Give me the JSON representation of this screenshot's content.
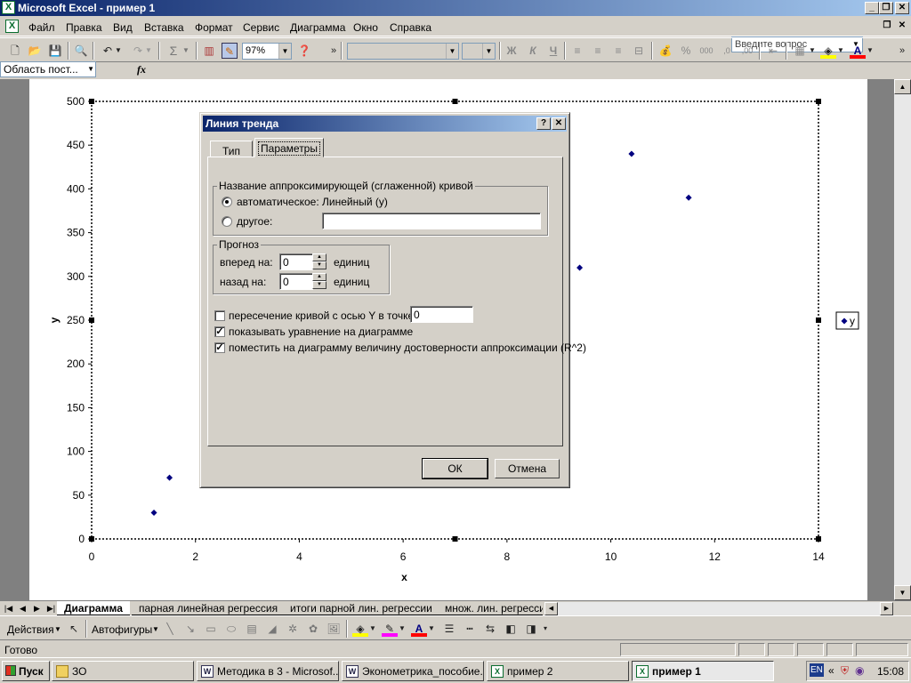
{
  "window": {
    "title": "Microsoft Excel - пример 1"
  },
  "menu": [
    "Файл",
    "Правка",
    "Вид",
    "Вставка",
    "Формат",
    "Сервис",
    "Диаграмма",
    "Окно",
    "Справка"
  ],
  "ask_placeholder": "Введите вопрос",
  "toolbar": {
    "zoom": "97%",
    "bold_icon": "Ж",
    "italic_icon": "К",
    "underline_icon": "Ч"
  },
  "formula_bar": {
    "name_box": "Область пост...",
    "fx": "fx"
  },
  "chart_data": {
    "type": "scatter",
    "x": [
      1.2,
      1.5,
      9.4,
      10.4,
      11.5
    ],
    "y": [
      30,
      70,
      310,
      440,
      390
    ],
    "xlabel": "x",
    "ylabel": "y",
    "xlim": [
      0,
      14
    ],
    "ylim": [
      0,
      500
    ],
    "xticks": [
      "0",
      "2",
      "4",
      "6",
      "8",
      "10",
      "12",
      "14"
    ],
    "yticks": [
      "0",
      "50",
      "100",
      "150",
      "200",
      "250",
      "300",
      "350",
      "400",
      "450",
      "500"
    ],
    "legend": {
      "entries": [
        "y"
      ],
      "placement": "right"
    },
    "grid": false,
    "marker_color": "#000080"
  },
  "dialog": {
    "title": "Линия тренда",
    "tabs": [
      "Тип",
      "Параметры"
    ],
    "name_group": "Название аппроксимирующей (сглаженной) кривой",
    "auto_label": "автоматическое:",
    "auto_value": "Линейный (y)",
    "other_label": "другое:",
    "forecast_group": "Прогноз",
    "forward_label": "вперед на:",
    "forward_value": "0",
    "back_label": "назад на:",
    "back_value": "0",
    "units": "единиц",
    "intercept_label": "пересечение кривой с осью Y в точке:",
    "intercept_value": "0",
    "show_equation": "показывать уравнение на диаграмме",
    "show_r2": "поместить на диаграмму величину достоверности аппроксимации (R^2)",
    "ok": "ОК",
    "cancel": "Отмена"
  },
  "sheet_tabs": [
    "Диаграмма",
    "парная линейная регрессия",
    "итоги парной лин. регрессии",
    "множ. лин. регресси"
  ],
  "drawing": {
    "actions": "Действия",
    "autoshapes": "Автофигуры"
  },
  "status": "Готово",
  "taskbar": {
    "start": "Пуск",
    "items": [
      "ЗО",
      "Методика в 3 - Microsof...",
      "Эконометрика_пособие...",
      "пример 2",
      "пример 1"
    ],
    "lang": "EN",
    "time": "15:08"
  }
}
